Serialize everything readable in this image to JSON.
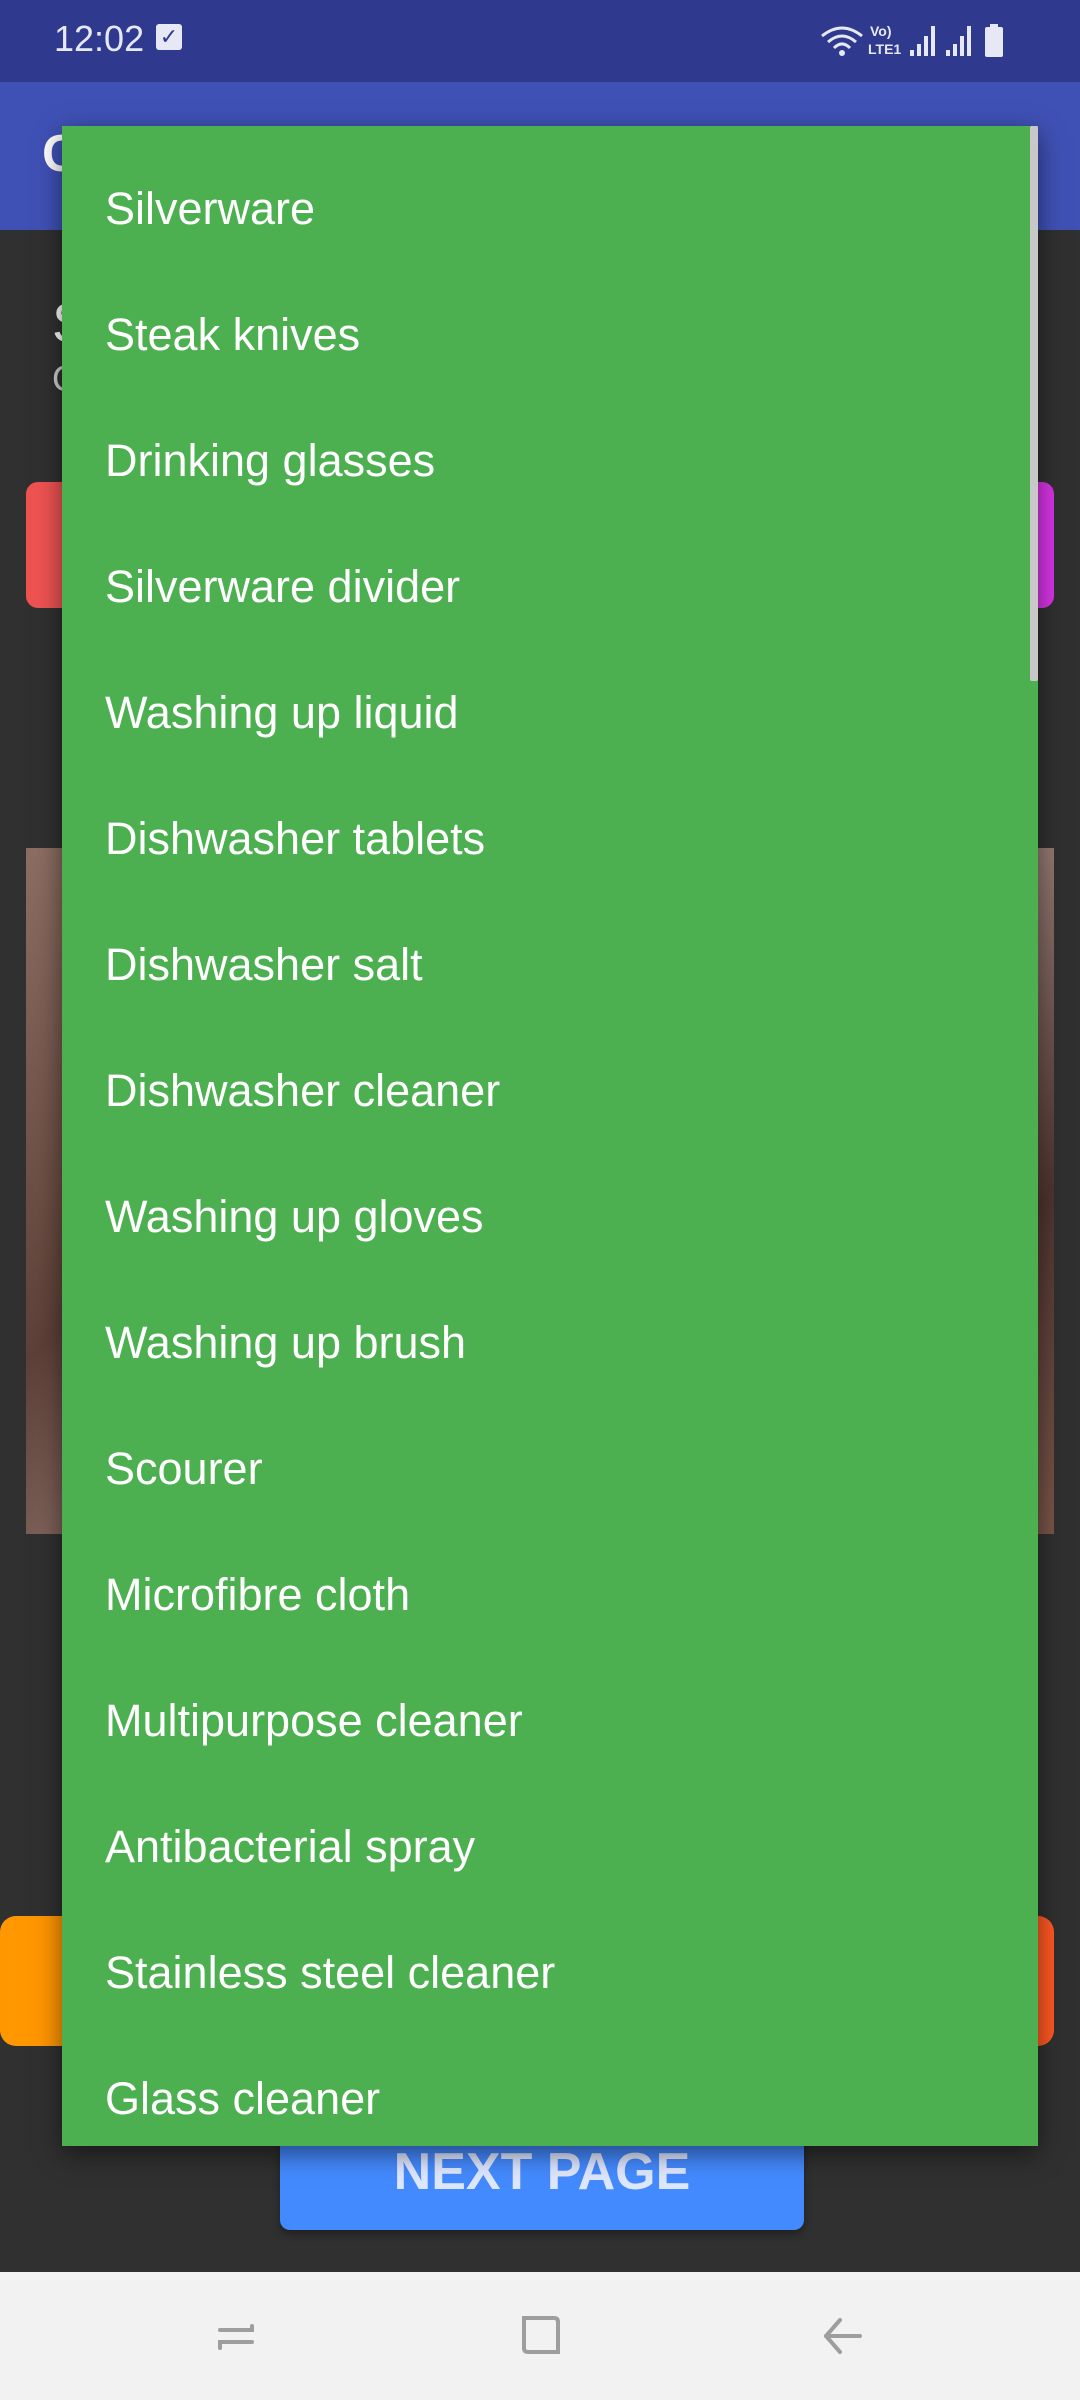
{
  "status_bar": {
    "time": "12:02",
    "network_label": "Vo) LTE1"
  },
  "toolbar": {
    "title": "C"
  },
  "background": {
    "heading": "S",
    "subheading": "C",
    "next_page_label": "NEXT PAGE"
  },
  "dropdown": {
    "items": [
      "Silverware",
      "Steak knives",
      "Drinking glasses",
      "Silverware divider",
      "Washing up liquid",
      "Dishwasher tablets",
      "Dishwasher salt",
      "Dishwasher cleaner",
      "Washing up gloves",
      "Washing up brush",
      "Scourer",
      "Microfibre cloth",
      "Multipurpose cleaner",
      "Antibacterial spray",
      "Stainless steel cleaner",
      "Glass cleaner"
    ],
    "background_color": "#4caf50"
  },
  "colors": {
    "status_bar": "#2f3a8f",
    "toolbar": "#3f51b5",
    "next_button": "#448aff",
    "orange_button": "#ff9800",
    "gradient_button_start": "#ef5350",
    "gradient_button_end": "#d633e6"
  },
  "icons": {
    "status": [
      "wifi-icon",
      "volte-lte-icon",
      "signal-icon",
      "signal-icon",
      "battery-icon"
    ],
    "navigation": [
      "recent-apps-icon",
      "home-icon",
      "back-icon"
    ]
  }
}
